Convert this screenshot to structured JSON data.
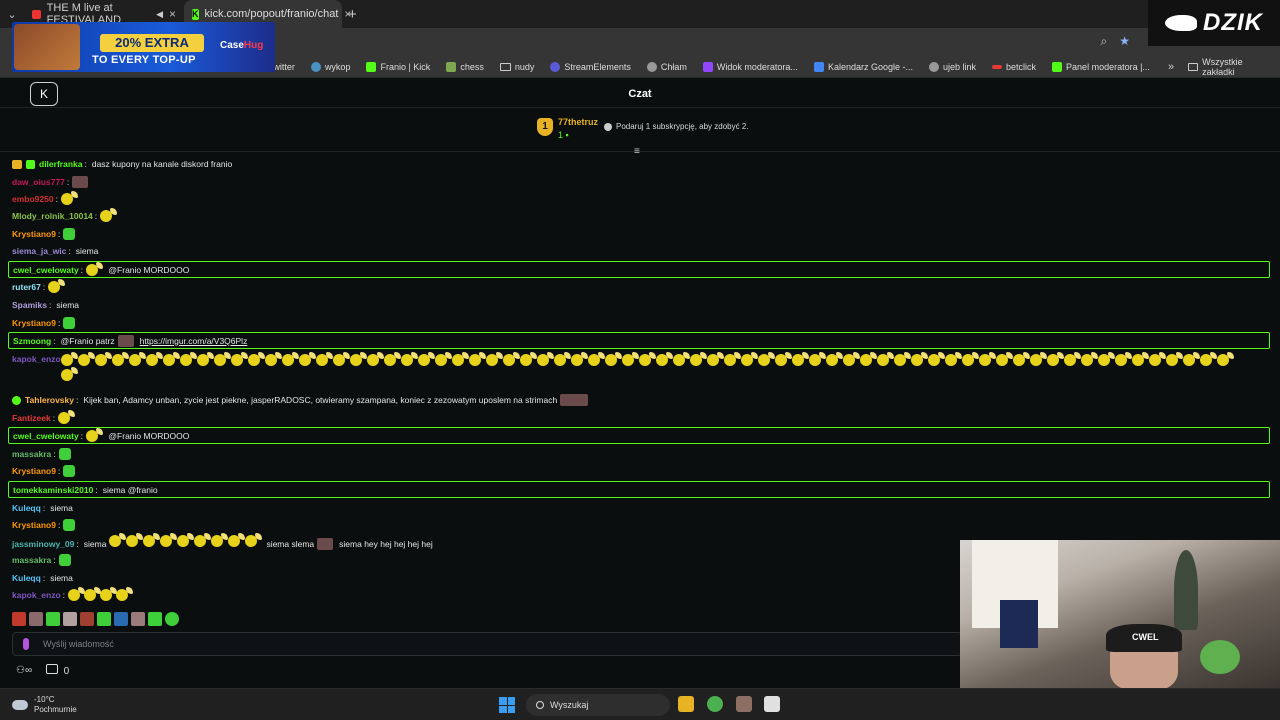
{
  "browser": {
    "tabs": [
      {
        "label": "THE M live at FESTIVALAND"
      },
      {
        "label": "kick.com/popout/franio/chat"
      }
    ],
    "bookmarks": [
      {
        "label": "twitter"
      },
      {
        "label": "wykop"
      },
      {
        "label": "Franio | Kick"
      },
      {
        "label": "chess"
      },
      {
        "label": "nudy"
      },
      {
        "label": "StreamElements"
      },
      {
        "label": "Chłam"
      },
      {
        "label": "Widok moderatora..."
      },
      {
        "label": "Kalendarz Google -..."
      },
      {
        "label": "ujeb link"
      },
      {
        "label": "betclick"
      },
      {
        "label": "Panel moderatora |..."
      }
    ],
    "all_bookmarks": "Wszystkie zakładki"
  },
  "ad": {
    "headline": "20% EXTRA",
    "sub": "TO EVERY TOP-UP",
    "brand_a": "Case",
    "brand_b": "Hug"
  },
  "watermark": {
    "text": "DZIK"
  },
  "chat": {
    "title": "Czat",
    "pinned": {
      "badge": "1",
      "user": "77thetruz",
      "count": "1",
      "info": "Podaruj 1 subskrypcję, aby zdobyć 2."
    },
    "messages": [
      {
        "user": "dilerfranka",
        "color": "#53fc18",
        "text": "dasz kupony na kanale diskord franio"
      },
      {
        "user": "daw_oius777",
        "color": "#c2185b",
        "text": ""
      },
      {
        "user": "embo9250",
        "color": "#d32f2f",
        "text": ""
      },
      {
        "user": "Mlody_rolnik_10014",
        "color": "#8bc34a",
        "text": ""
      },
      {
        "user": "Krystiano9",
        "color": "#ff9800",
        "text": ""
      },
      {
        "user": "siema_ja_wic",
        "color": "#9c8ad6",
        "text": "siema"
      },
      {
        "user": "cwel_cwelowaty",
        "color": "#53fc18",
        "text": "@Franio MORDOOO"
      },
      {
        "user": "ruter67",
        "color": "#8ee3f5",
        "text": ""
      },
      {
        "user": "Spamiks",
        "color": "#b39ddb",
        "text": "siema"
      },
      {
        "user": "Krystiano9",
        "color": "#ff9800",
        "text": ""
      },
      {
        "user": "Szmoong",
        "color": "#53fc18",
        "text": "@Franio patrz",
        "link": "https://imgur.com/a/V3Q6Plz"
      },
      {
        "user": "kapok_enzo",
        "color": "#7e57c2",
        "text": ""
      },
      {
        "user": "Tahlerovsky",
        "color": "#ffb74d",
        "text": "Kijek ban, Adamcy unban, zycie jest piekne, jasperRADOSC, otwieramy szampana, koniec z zezowatym uposlem na strimach"
      },
      {
        "user": "Fantizeek",
        "color": "#e53935",
        "text": ""
      },
      {
        "user": "cwel_cwelowaty",
        "color": "#53fc18",
        "text": "@Franio MORDOOO"
      },
      {
        "user": "massakra",
        "color": "#66bb6a",
        "text": ""
      },
      {
        "user": "Krystiano9",
        "color": "#ff9800",
        "text": ""
      },
      {
        "user": "tomekkaminski2010",
        "color": "#53fc18",
        "text": "siema @franio"
      },
      {
        "user": "Kuleqq",
        "color": "#4fc3f7",
        "text": "siema"
      },
      {
        "user": "Krystiano9",
        "color": "#ff9800",
        "text": ""
      },
      {
        "user": "jassminowy_09",
        "color": "#4db6ac",
        "text": "siema",
        "text2": "siema slema",
        "text3": "siema hey hej hej hej hej"
      },
      {
        "user": "massakra",
        "color": "#66bb6a",
        "text": ""
      },
      {
        "user": "Kuleqq",
        "color": "#4fc3f7",
        "text": "siema"
      },
      {
        "user": "kapok_enzo",
        "color": "#7e57c2",
        "text": ""
      }
    ],
    "input_placeholder": "Wyślij wiadomość",
    "points": "0"
  },
  "webcam": {
    "cap_text": "CWEL"
  },
  "taskbar": {
    "temp": "-10°C",
    "weather": "Pochmurnie",
    "search": "Wyszukaj"
  }
}
